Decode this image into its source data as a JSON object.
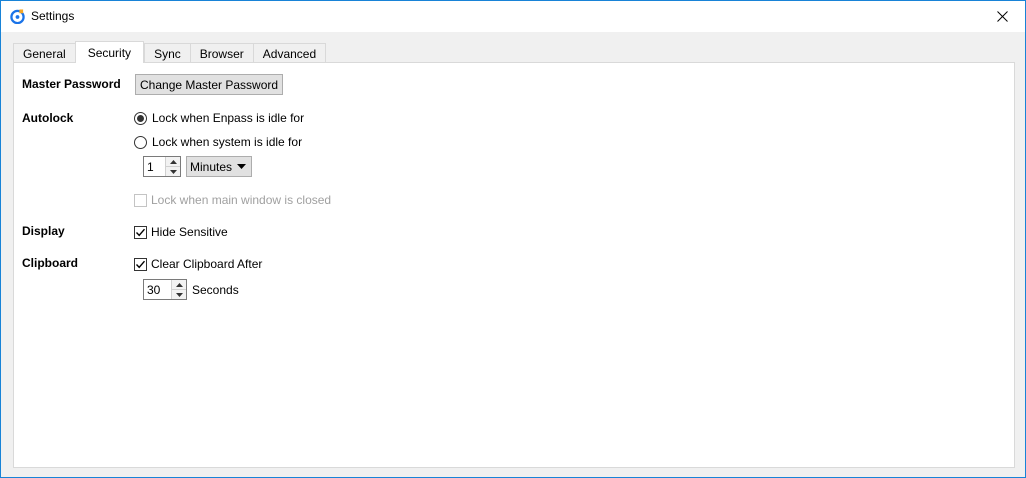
{
  "window": {
    "title": "Settings"
  },
  "tabs": [
    {
      "label": "General",
      "active": false
    },
    {
      "label": "Security",
      "active": true
    },
    {
      "label": "Sync",
      "active": false
    },
    {
      "label": "Browser",
      "active": false
    },
    {
      "label": "Advanced",
      "active": false
    }
  ],
  "master_password": {
    "label": "Master Password",
    "button_label": "Change Master Password"
  },
  "autolock": {
    "label": "Autolock",
    "option_enpass_idle": "Lock when Enpass is idle for",
    "option_system_idle": "Lock when system is idle for",
    "selected": "enpass_idle",
    "duration_value": "1",
    "duration_unit": "Minutes",
    "lock_on_close_label": "Lock when main window is closed",
    "lock_on_close_checked": false,
    "lock_on_close_enabled": false
  },
  "display": {
    "label": "Display",
    "hide_sensitive_label": "Hide Sensitive",
    "hide_sensitive_checked": true
  },
  "clipboard": {
    "label": "Clipboard",
    "clear_after_label": "Clear Clipboard After",
    "clear_after_checked": true,
    "seconds_value": "30",
    "seconds_label": "Seconds"
  },
  "colors": {
    "window_border": "#1883d7",
    "app_icon_blue": "#1a73e8",
    "app_icon_orange": "#f5a623"
  }
}
